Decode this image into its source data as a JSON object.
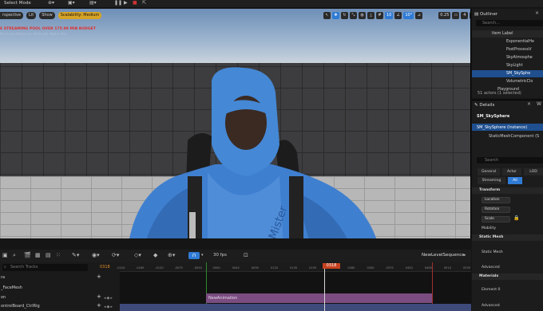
{
  "toolbar": {
    "select_mode": "Select Mode",
    "play_icon": "play-icon",
    "pause_icon": "pause-icon",
    "stop_icon": "stop-icon"
  },
  "viewport": {
    "buttons": [
      "rspective",
      "Lit",
      "Show",
      "Scalability: Medium"
    ],
    "tools": [
      "10",
      "10°",
      "0.25",
      "4"
    ],
    "warning": "E STREAMING POOL OVER 175.99 MiB BUDGET",
    "sub_warning": "PersistentMaterial (Default) Alpha Bid"
  },
  "sequencer": {
    "fps": "30 fps",
    "sequence_name": "NewLevelSequence",
    "search_placeholder": "Search Tracks",
    "current_frame": "0318",
    "playhead_frame": "0318",
    "ticks": [
      "-0210",
      "-0165",
      "-0120",
      "-0075",
      "-0030",
      "0000",
      "0045",
      "0090",
      "0120",
      "0150",
      "0195",
      "0240",
      "0285",
      "0330",
      "0375",
      "0420",
      "0465",
      "0510",
      "0555"
    ],
    "tracks": [
      {
        "label": "ra"
      },
      {
        "label": "_FaceMesh"
      },
      {
        "label": "on"
      },
      {
        "label": "ontrolBoard_CtrlRig"
      }
    ],
    "anim_section": "NewAnimation"
  },
  "outliner": {
    "tab": "Outliner",
    "search_placeholder": "Search...",
    "header": "Item Label",
    "items": [
      {
        "label": "ExponentialHe"
      },
      {
        "label": "PostProcessV"
      },
      {
        "label": "SkyAtmosphe"
      },
      {
        "label": "SkyLight"
      },
      {
        "label": "SM_SkySphe",
        "selected": true
      },
      {
        "label": "VolumetricClo"
      },
      {
        "label": "Playground"
      }
    ],
    "actor_count": "51 actors (1 selected)"
  },
  "details": {
    "tab": "Details",
    "actor_name": "SM_SkySphere",
    "instance": "SM_SkySphere (Instance)",
    "component": "StaticMeshComponent (S",
    "search_placeholder": "Search",
    "categories": [
      "General",
      "Actor",
      "LOD",
      "Streaming",
      "All"
    ],
    "transform_section": "Transform",
    "location": "Location",
    "rotation": "Rotation",
    "scale": "Scale",
    "mobility": "Mobility",
    "static_mesh_section": "Static Mesh",
    "static_mesh": "Static Mesh",
    "advanced": "Advanced",
    "materials_section": "Materials",
    "element": "Element 0",
    "advanced2": "Advanced"
  },
  "colors": {
    "accent": "#d7a326",
    "selection": "#2f7bd6",
    "playhead": "#c6421f",
    "anim_section": "#7a4c80"
  }
}
